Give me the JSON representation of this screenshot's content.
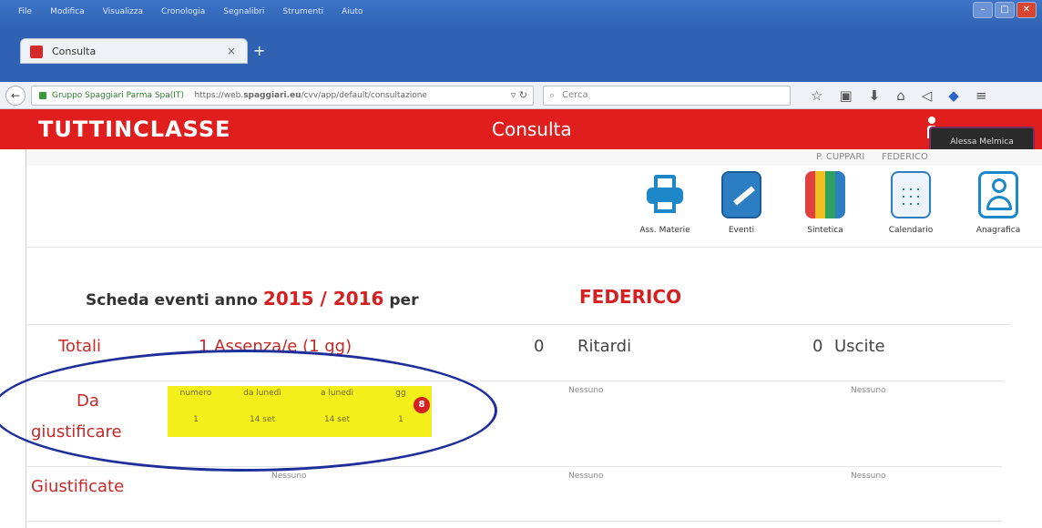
{
  "browser": {
    "menu": [
      "File",
      "Modifica",
      "Visualizza",
      "Cronologia",
      "Segnalibri",
      "Strumenti",
      "Aiuto"
    ],
    "tab_title": "Consulta",
    "url_site": "Gruppo Spaggiari Parma Spa(IT)",
    "url_prefix": "https://web.",
    "url_domain": "spaggiari.eu",
    "url_path": "/cvv/app/default/consultazione",
    "search_placeholder": "Cerca"
  },
  "app": {
    "logo": "TUTTINCLASSE",
    "title": "Consulta",
    "tooltip": "Alessa Melmica",
    "teacher": "P. CUPPARI",
    "student_header": "FEDERICO"
  },
  "toolbar": {
    "buttons": [
      "Ass. Materie",
      "Eventi",
      "Sintetica",
      "Calendario",
      "Anagrafica"
    ]
  },
  "scheda": {
    "prefix": "Scheda eventi anno",
    "year": "2015 / 2016",
    "per": "per",
    "student": "FEDERICO"
  },
  "totali": {
    "label": "Totali",
    "assenze": "1 Assenza/e (1 gg)",
    "ritardi_count": "0",
    "ritardi_label": "Ritardi",
    "uscite_count": "0",
    "uscite_label": "Uscite"
  },
  "da_giustificare": {
    "label_1": "Da",
    "label_2": "giustificare",
    "headers": [
      "numero",
      "da lunedì",
      "a lunedì",
      "gg"
    ],
    "row": [
      "1",
      "14 set",
      "14 set",
      "1"
    ],
    "badge": "8",
    "ritardi": "Nessuno",
    "uscite": "Nessuno"
  },
  "giustificate": {
    "label": "Giustificate",
    "assenze": "Nessuno",
    "ritardi": "Nessuno",
    "uscite": "Nessuno"
  },
  "colors": {
    "brand_red": "#e01e1e",
    "highlight_yellow": "#f3ef1a",
    "ellipse_blue": "#1f2f99"
  }
}
